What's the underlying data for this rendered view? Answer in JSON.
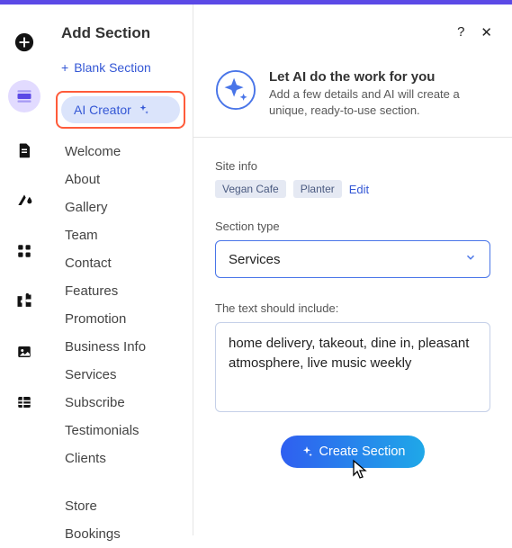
{
  "panel": {
    "title": "Add Section",
    "blank": "Blank Section",
    "ai_creator": "AI Creator",
    "items": [
      "Welcome",
      "About",
      "Gallery",
      "Team",
      "Contact",
      "Features",
      "Promotion",
      "Business Info",
      "Services",
      "Subscribe",
      "Testimonials",
      "Clients"
    ],
    "items2": [
      "Store",
      "Bookings"
    ]
  },
  "intro": {
    "title": "Let AI do the work for you",
    "sub": "Add a few details and AI will create a unique, ready-to-use section."
  },
  "siteinfo": {
    "label": "Site info",
    "tags": [
      "Vegan Cafe",
      "Planter"
    ],
    "edit": "Edit"
  },
  "sectiontype": {
    "label": "Section type",
    "value": "Services"
  },
  "include": {
    "label": "The text should include:",
    "value": "home delivery, takeout, dine in, pleasant atmosphere, live music weekly"
  },
  "cta": "Create Section",
  "ctrls": {
    "help": "?",
    "close": "✕"
  }
}
